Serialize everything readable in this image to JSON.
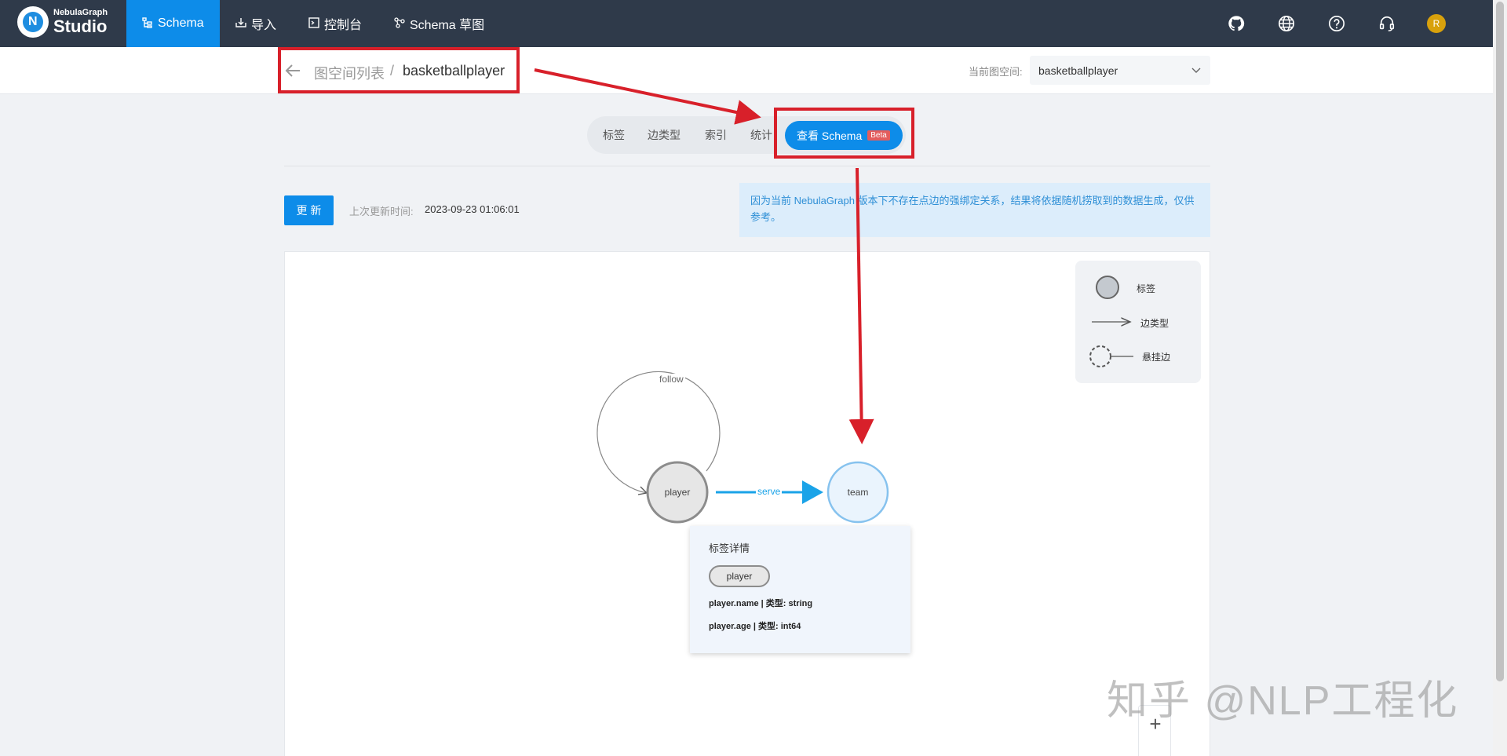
{
  "nav": {
    "logo_small": "NebulaGraph",
    "logo_big": "Studio",
    "items": [
      {
        "label": "Schema",
        "icon": "schema-icon",
        "active": true
      },
      {
        "label": "导入",
        "icon": "import-icon"
      },
      {
        "label": "控制台",
        "icon": "console-icon"
      },
      {
        "label": "Schema 草图",
        "icon": "sketch-icon"
      }
    ],
    "right_icons": [
      "github-icon",
      "globe-icon",
      "help-icon",
      "headset-icon"
    ],
    "avatar": "R"
  },
  "breadcrumb": {
    "list": "图空间列表",
    "separator": "/",
    "current": "basketballplayer"
  },
  "space": {
    "label": "当前图空间:",
    "value": "basketballplayer"
  },
  "tabs": [
    {
      "label": "标签"
    },
    {
      "label": "边类型"
    },
    {
      "label": "索引"
    },
    {
      "label": "统计"
    },
    {
      "label": "查看 Schema",
      "badge": "Beta",
      "active": true
    }
  ],
  "toolbar": {
    "update_label": "更 新",
    "last_update_label": "上次更新时间:",
    "last_update_time": "2023-09-23 01:06:01"
  },
  "notice": "因为当前 NebulaGraph 版本下不存在点边的强绑定关系，结果将依据随机捞取到的数据生成，仅供参考。",
  "legend": {
    "tag": "标签",
    "edge": "边类型",
    "dangling": "悬挂边"
  },
  "graph": {
    "nodes": [
      {
        "label": "player"
      },
      {
        "label": "team"
      }
    ],
    "edges": [
      {
        "label": "follow"
      },
      {
        "label": "serve"
      }
    ]
  },
  "detail": {
    "title": "标签详情",
    "tag": "player",
    "props": [
      "player.name | 类型: string",
      "player.age | 类型: int64"
    ]
  },
  "zoom": {
    "plus": "+"
  },
  "watermark": "知乎 @NLP工程化",
  "colors": {
    "nav_bg": "#2f3a4a",
    "accent": "#0d8ce9",
    "annotation": "#d8202a",
    "notice_bg": "#dcedfb"
  }
}
